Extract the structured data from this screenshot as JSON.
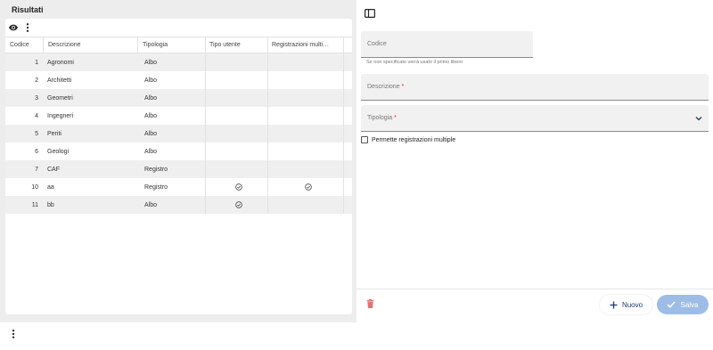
{
  "results": {
    "title": "Risultati",
    "columns": [
      "Codice",
      "Descrizione",
      "Tipologia",
      "Tipo utente",
      "Registrazioni multi…"
    ],
    "rows": [
      {
        "codice": "1",
        "descrizione": "Agronomi",
        "tipologia": "Albo",
        "tipo_utente": false,
        "registrazioni_multiple": false
      },
      {
        "codice": "2",
        "descrizione": "Architetti",
        "tipologia": "Albo",
        "tipo_utente": false,
        "registrazioni_multiple": false
      },
      {
        "codice": "3",
        "descrizione": "Geometri",
        "tipologia": "Albo",
        "tipo_utente": false,
        "registrazioni_multiple": false
      },
      {
        "codice": "4",
        "descrizione": "Ingegneri",
        "tipologia": "Albo",
        "tipo_utente": false,
        "registrazioni_multiple": false
      },
      {
        "codice": "5",
        "descrizione": "Periti",
        "tipologia": "Albo",
        "tipo_utente": false,
        "registrazioni_multiple": false
      },
      {
        "codice": "6",
        "descrizione": "Geologi",
        "tipologia": "Albo",
        "tipo_utente": false,
        "registrazioni_multiple": false
      },
      {
        "codice": "7",
        "descrizione": "CAF",
        "tipologia": "Registro",
        "tipo_utente": false,
        "registrazioni_multiple": false
      },
      {
        "codice": "10",
        "descrizione": "aa",
        "tipologia": "Registro",
        "tipo_utente": true,
        "registrazioni_multiple": true
      },
      {
        "codice": "11",
        "descrizione": "bb",
        "tipologia": "Albo",
        "tipo_utente": true,
        "registrazioni_multiple": false
      }
    ]
  },
  "form": {
    "codice_label": "Codice",
    "codice_helper": "Se non specificato verrà usato il primo libero",
    "descrizione_label": "Descrizione",
    "tipologia_label": "Tipologia",
    "required_mark": "*",
    "multiple_label": "Permette registrazioni multiple",
    "multiple_checked": false
  },
  "actions": {
    "new_label": "Nuovo",
    "save_label": "Salva"
  },
  "colors": {
    "accent": "#1e3a6e",
    "save_disabled": "#9ebde6",
    "delete": "#e57373"
  },
  "icons": [
    "eye-icon",
    "more-vert-icon",
    "check-circle-icon",
    "sidebar-toggle-icon",
    "chevron-down-icon",
    "trash-icon",
    "plus-icon",
    "check-icon"
  ]
}
